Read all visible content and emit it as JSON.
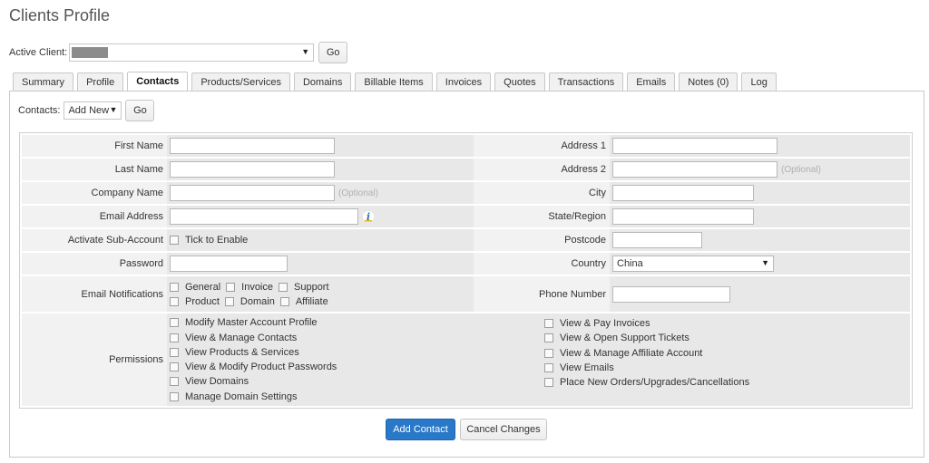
{
  "page": {
    "title": "Clients Profile"
  },
  "active_client": {
    "label": "Active Client:",
    "go_label": "Go"
  },
  "tabs": [
    {
      "label": "Summary"
    },
    {
      "label": "Profile"
    },
    {
      "label": "Contacts",
      "active": true
    },
    {
      "label": "Products/Services"
    },
    {
      "label": "Domains"
    },
    {
      "label": "Billable Items"
    },
    {
      "label": "Invoices"
    },
    {
      "label": "Quotes"
    },
    {
      "label": "Transactions"
    },
    {
      "label": "Emails"
    },
    {
      "label": "Notes (0)"
    },
    {
      "label": "Log"
    }
  ],
  "contacts": {
    "label": "Contacts:",
    "selected": "Add New",
    "go_label": "Go"
  },
  "form": {
    "first_name": {
      "label": "First Name",
      "value": ""
    },
    "last_name": {
      "label": "Last Name",
      "value": ""
    },
    "company_name": {
      "label": "Company Name",
      "value": "",
      "hint": "(Optional)"
    },
    "email_address": {
      "label": "Email Address",
      "value": ""
    },
    "activate_sub_account": {
      "label": "Activate Sub-Account",
      "checkbox_label": "Tick to Enable"
    },
    "password": {
      "label": "Password",
      "value": ""
    },
    "email_notifications": {
      "label": "Email Notifications",
      "options": [
        "General",
        "Invoice",
        "Support",
        "Product",
        "Domain",
        "Affiliate"
      ]
    },
    "address1": {
      "label": "Address 1",
      "value": ""
    },
    "address2": {
      "label": "Address 2",
      "value": "",
      "hint": "(Optional)"
    },
    "city": {
      "label": "City",
      "value": ""
    },
    "state": {
      "label": "State/Region",
      "value": ""
    },
    "postcode": {
      "label": "Postcode",
      "value": ""
    },
    "country": {
      "label": "Country",
      "selected": "China"
    },
    "phone": {
      "label": "Phone Number",
      "value": ""
    },
    "permissions": {
      "label": "Permissions",
      "left": [
        "Modify Master Account Profile",
        "View & Manage Contacts",
        "View Products & Services",
        "View & Modify Product Passwords",
        "View Domains",
        "Manage Domain Settings"
      ],
      "right": [
        "View & Pay Invoices",
        "View & Open Support Tickets",
        "View & Manage Affiliate Account",
        "View Emails",
        "Place New Orders/Upgrades/Cancellations"
      ]
    }
  },
  "buttons": {
    "add_contact": "Add Contact",
    "cancel": "Cancel Changes"
  },
  "colors": {
    "primary": "#2a78c8",
    "label_bg": "#f2f2f2",
    "field_bg": "#e8e8e8"
  }
}
